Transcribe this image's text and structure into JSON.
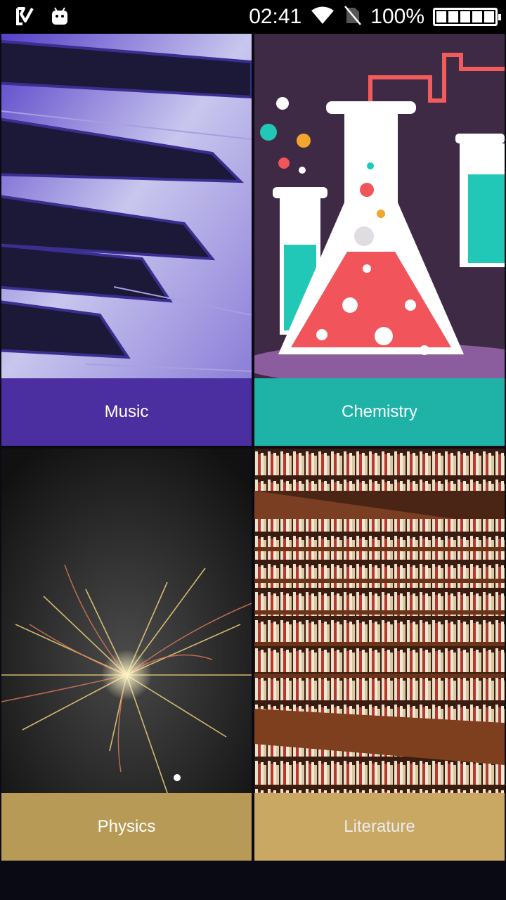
{
  "status_bar": {
    "time": "02:41",
    "battery_percent": "100%",
    "icons": [
      "check-app-icon",
      "android-icon",
      "wifi-icon",
      "no-sim-icon",
      "battery-icon"
    ]
  },
  "tiles": [
    {
      "label": "Music",
      "color": "#4b2fa0",
      "image": "piano-keys"
    },
    {
      "label": "Chemistry",
      "color": "#1fb3a8",
      "image": "chemistry-flasks"
    },
    {
      "label": "Physics",
      "color": "#b79a55",
      "image": "particle-collision"
    },
    {
      "label": "Literature",
      "color": "#d9b66a",
      "image": "library-bookshelves"
    }
  ]
}
